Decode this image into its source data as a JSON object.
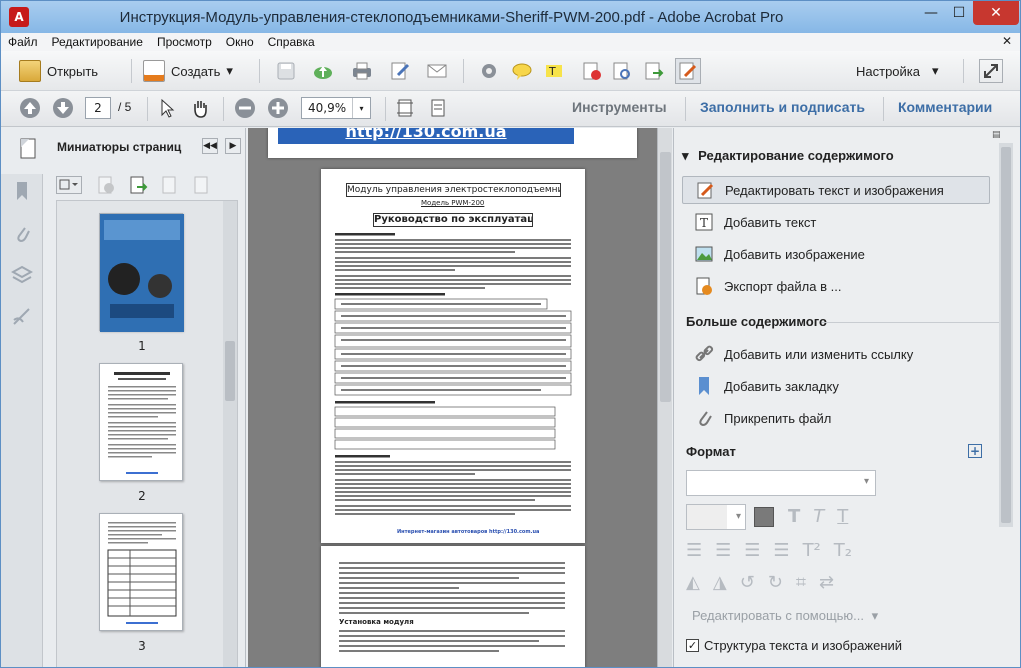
{
  "window": {
    "title": "Инструкция-Модуль-управления-стеклоподъемниками-Sheriff-PWM-200.pdf - Adobe Acrobat Pro",
    "app_icon_glyph": "A",
    "min_glyph": "—",
    "max_glyph": "☐",
    "close_glyph": "✕"
  },
  "menubar": {
    "items": [
      "Файл",
      "Редактирование",
      "Просмотр",
      "Окно",
      "Справка"
    ],
    "close_glyph": "✕"
  },
  "toolbar1": {
    "open_label": "Открыть",
    "create_label": "Создать",
    "settings_label": "Настройка",
    "dropdown_glyph": "▾"
  },
  "toolbar2": {
    "page_current": "2",
    "page_total": "/ 5",
    "zoom_value": "40,9%",
    "tools_label": "Инструменты",
    "fill_sign_label": "Заполнить и подписать",
    "comments_label": "Комментарии"
  },
  "left_panel": {
    "title": "Миниатюры страниц",
    "thumbnails": [
      {
        "number": "1"
      },
      {
        "number": "2"
      },
      {
        "number": "3"
      }
    ]
  },
  "document": {
    "page2": {
      "header_box": "Модуль управления электростеклоподъемниками",
      "model": "Модель PWM-200",
      "heading": "Руководство по эксплуатации",
      "footer_link": "Интернет-магазин автотоваров http://130.com.ua"
    },
    "page1_partial": {
      "link_text": "http://130.com.ua"
    },
    "page3": {
      "section": "Установка модуля"
    }
  },
  "right_panel": {
    "section_title": "Редактирование содержимого",
    "items": [
      {
        "label": "Редактировать текст и изображения",
        "icon": "edit-text-image-icon",
        "active": true
      },
      {
        "label": "Добавить текст",
        "icon": "add-text-icon",
        "active": false
      },
      {
        "label": "Добавить изображение",
        "icon": "add-image-icon",
        "active": false
      },
      {
        "label": "Экспорт файла в ...",
        "icon": "export-file-icon",
        "active": false
      }
    ],
    "more_title": "Больше содержимого",
    "more_items": [
      {
        "label": "Добавить или изменить ссылку",
        "icon": "link-icon"
      },
      {
        "label": "Добавить закладку",
        "icon": "bookmark-icon"
      },
      {
        "label": "Прикрепить файл",
        "icon": "paperclip-icon"
      }
    ],
    "format_title": "Формат",
    "edit_with_label": "Редактировать с помощью...",
    "structure_checkbox_label": "Структура текста и изображений",
    "structure_checked": true,
    "plus_glyph": "+",
    "dropdown_glyph": "▾",
    "check_glyph": "✓"
  }
}
